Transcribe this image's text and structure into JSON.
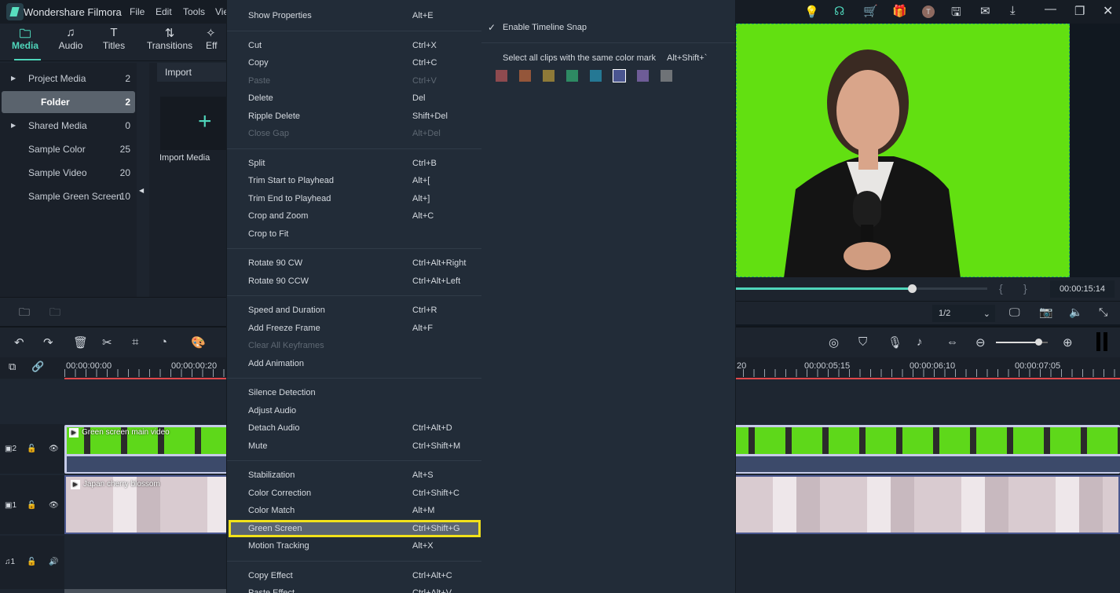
{
  "app": {
    "title": "Wondershare Filmora",
    "menus": [
      "File",
      "Edit",
      "Tools",
      "Vie"
    ]
  },
  "tabs": [
    {
      "label": "Media",
      "icon": "folder-icon"
    },
    {
      "label": "Audio",
      "icon": "music-icon"
    },
    {
      "label": "Titles",
      "icon": "text-icon"
    },
    {
      "label": "Transitions",
      "icon": "transitions-icon"
    },
    {
      "label": "Eff",
      "icon": "effects-icon"
    }
  ],
  "sidebar": [
    {
      "name": "Project Media",
      "count": "2"
    },
    {
      "name": "Folder",
      "count": "2"
    },
    {
      "name": "Shared Media",
      "count": "0"
    },
    {
      "name": "Sample Color",
      "count": "25"
    },
    {
      "name": "Sample Video",
      "count": "20"
    },
    {
      "name": "Sample Green Screen",
      "count": "10"
    }
  ],
  "media": {
    "import_label": "Import",
    "import_media": "Import Media"
  },
  "context_menu": [
    [
      {
        "label": "Show Properties",
        "shortcut": "Alt+E"
      }
    ],
    [
      {
        "label": "Cut",
        "shortcut": "Ctrl+X"
      },
      {
        "label": "Copy",
        "shortcut": "Ctrl+C"
      },
      {
        "label": "Paste",
        "shortcut": "Ctrl+V",
        "disabled": true
      },
      {
        "label": "Delete",
        "shortcut": "Del"
      },
      {
        "label": "Ripple Delete",
        "shortcut": "Shift+Del"
      },
      {
        "label": "Close Gap",
        "shortcut": "Alt+Del",
        "disabled": true
      }
    ],
    [
      {
        "label": "Split",
        "shortcut": "Ctrl+B"
      },
      {
        "label": "Trim Start to Playhead",
        "shortcut": "Alt+["
      },
      {
        "label": "Trim End to Playhead",
        "shortcut": "Alt+]"
      },
      {
        "label": "Crop and Zoom",
        "shortcut": "Alt+C"
      },
      {
        "label": "Crop to Fit",
        "shortcut": ""
      }
    ],
    [
      {
        "label": "Rotate 90 CW",
        "shortcut": "Ctrl+Alt+Right"
      },
      {
        "label": "Rotate 90 CCW",
        "shortcut": "Ctrl+Alt+Left"
      }
    ],
    [
      {
        "label": "Speed and Duration",
        "shortcut": "Ctrl+R"
      },
      {
        "label": "Add Freeze Frame",
        "shortcut": "Alt+F"
      },
      {
        "label": "Clear All Keyframes",
        "shortcut": "",
        "disabled": true
      },
      {
        "label": "Add Animation",
        "shortcut": ""
      }
    ],
    [
      {
        "label": "Silence Detection",
        "shortcut": ""
      },
      {
        "label": "Adjust Audio",
        "shortcut": ""
      },
      {
        "label": "Detach Audio",
        "shortcut": "Ctrl+Alt+D"
      },
      {
        "label": "Mute",
        "shortcut": "Ctrl+Shift+M"
      }
    ],
    [
      {
        "label": "Stabilization",
        "shortcut": "Alt+S"
      },
      {
        "label": "Color Correction",
        "shortcut": "Ctrl+Shift+C"
      },
      {
        "label": "Color Match",
        "shortcut": "Alt+M"
      },
      {
        "label": "Green Screen",
        "shortcut": "Ctrl+Shift+G",
        "highlighted": true
      },
      {
        "label": "Motion Tracking",
        "shortcut": "Alt+X"
      }
    ],
    [
      {
        "label": "Copy Effect",
        "shortcut": "Ctrl+Alt+C"
      },
      {
        "label": "Paste Effect",
        "shortcut": "Ctrl+Alt+V"
      }
    ]
  ],
  "submenu": {
    "snap": "Enable Timeline Snap",
    "snap_checked": true,
    "color_mark_label": "Select all clips with the same color mark",
    "color_mark_shortcut": "Alt+Shift+`",
    "swatches": [
      "#8e4a4f",
      "#94563a",
      "#8e7a38",
      "#2e8a63",
      "#257894",
      "#4a5590",
      "#6e5c97",
      "#6f7377"
    ],
    "selected_swatch": 5
  },
  "preview": {
    "time": "00:00:15:14",
    "progress": 0.7,
    "quality": "1/2"
  },
  "timeline": {
    "ruler": [
      "00:00:00:00",
      "00:00:00:20",
      "20",
      "00:00:05:15",
      "00:00:06:10",
      "00:00:07:05"
    ],
    "tracks": [
      {
        "label": "2",
        "clip": "Green screen main video"
      },
      {
        "label": "1",
        "clip": "Japan cherry blossom"
      },
      {
        "label": "1"
      }
    ],
    "zoom": 0.82
  }
}
